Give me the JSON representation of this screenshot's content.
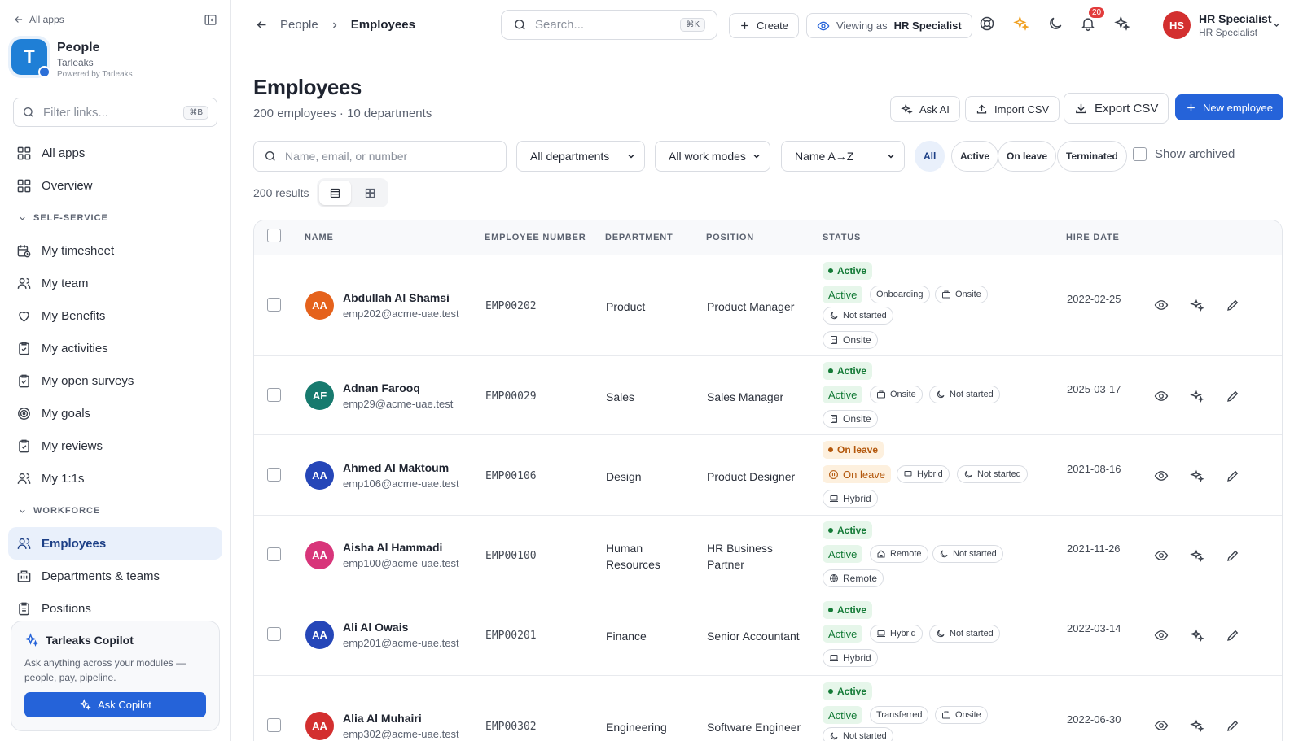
{
  "colors": {
    "accent": "#2563d9",
    "active_green": "#137a36",
    "leave_orange": "#b3570b",
    "avatar_orange": "#e5621c",
    "avatar_teal": "#177a6e",
    "avatar_blue": "#2546b8",
    "avatar_pink": "#d8357a",
    "avatar_red": "#d32f2f"
  },
  "sidebar": {
    "back_label": "All apps",
    "app_title": "People",
    "app_org": "Tarleaks",
    "app_powered": "Powered by Tarleaks",
    "logo_letter": "T",
    "filter_placeholder": "Filter links...",
    "filter_shortcut": "⌘B",
    "items_top": [
      {
        "label": "All apps",
        "icon": "grid-icon"
      },
      {
        "label": "Overview",
        "icon": "grid-icon"
      }
    ],
    "section_self": "SELF-SERVICE",
    "items_self": [
      {
        "label": "My timesheet",
        "icon": "calendar-clock-icon"
      },
      {
        "label": "My team",
        "icon": "users-icon"
      },
      {
        "label": "My Benefits",
        "icon": "heart-hand-icon"
      },
      {
        "label": "My activities",
        "icon": "clipboard-check-icon"
      },
      {
        "label": "My open surveys",
        "icon": "clipboard-check-icon"
      },
      {
        "label": "My goals",
        "icon": "target-icon"
      },
      {
        "label": "My reviews",
        "icon": "clipboard-check-icon"
      },
      {
        "label": "My 1:1s",
        "icon": "users-icon"
      }
    ],
    "section_work": "WORKFORCE",
    "items_work": [
      {
        "label": "Employees",
        "icon": "users-icon"
      },
      {
        "label": "Departments & teams",
        "icon": "building-icon"
      },
      {
        "label": "Positions",
        "icon": "clipboard-icon"
      }
    ],
    "copilot": {
      "title": "Tarleaks Copilot",
      "desc": "Ask anything across your modules — people, pay, pipeline.",
      "button": "Ask Copilot"
    }
  },
  "topbar": {
    "crumb_parent": "People",
    "crumb_current": "Employees",
    "search_placeholder": "Search...",
    "search_shortcut": "⌘K",
    "create_label": "Create",
    "viewing_prefix": "Viewing as",
    "viewing_role": "HR Specialist",
    "notif_count": "20",
    "user_initials": "HS",
    "user_name": "HR Specialist",
    "user_role": "HR Specialist"
  },
  "page": {
    "title": "Employees",
    "subtitle": "200 employees · 10 departments",
    "ask_ai": "Ask AI",
    "import_csv": "Import CSV",
    "export_csv": "Export CSV",
    "new_employee": "New employee",
    "filter_search_placeholder": "Name, email, or number",
    "dept_select": "All departments",
    "mode_select": "All work modes",
    "sort_select": "Name A→Z",
    "status_pills": [
      "All",
      "Active",
      "On leave",
      "Terminated"
    ],
    "show_archived": "Show archived",
    "results": "200 results"
  },
  "table": {
    "headers": {
      "name": "NAME",
      "number": "EMPLOYEE NUMBER",
      "department": "DEPARTMENT",
      "position": "POSITION",
      "status": "STATUS",
      "hire": "HIRE DATE"
    },
    "rows": [
      {
        "initials": "AA",
        "name": "Abdullah Al Shamsi",
        "email": "emp202@acme-uae.test",
        "number": "EMP00202",
        "department": "Product",
        "position": "Product Manager",
        "status": "Active",
        "sub_status": "Active",
        "tag1": "Onboarding",
        "tag2": "Onsite",
        "tag3": "Not started",
        "mode": "Onsite",
        "hire": "2022-02-25"
      },
      {
        "initials": "AF",
        "name": "Adnan Farooq",
        "email": "emp29@acme-uae.test",
        "number": "EMP00029",
        "department": "Sales",
        "position": "Sales Manager",
        "status": "Active",
        "sub_status": "Active",
        "tag1": "Onsite",
        "tag2": "Not started",
        "mode": "Onsite",
        "hire": "2025-03-17"
      },
      {
        "initials": "AA",
        "name": "Ahmed Al Maktoum",
        "email": "emp106@acme-uae.test",
        "number": "EMP00106",
        "department": "Design",
        "position": "Product Designer",
        "status": "On leave",
        "sub_status": "On leave",
        "tag1": "Hybrid",
        "tag2": "Not started",
        "mode": "Hybrid",
        "hire": "2021-08-16"
      },
      {
        "initials": "AA",
        "name": "Aisha Al Hammadi",
        "email": "emp100@acme-uae.test",
        "number": "EMP00100",
        "department": "Human Resources",
        "position": "HR Business Partner",
        "status": "Active",
        "sub_status": "Active",
        "tag1": "Remote",
        "tag2": "Not started",
        "mode": "Remote",
        "hire": "2021-11-26"
      },
      {
        "initials": "AA",
        "name": "Ali Al Owais",
        "email": "emp201@acme-uae.test",
        "number": "EMP00201",
        "department": "Finance",
        "position": "Senior Accountant",
        "status": "Active",
        "sub_status": "Active",
        "tag1": "Hybrid",
        "tag2": "Not started",
        "mode": "Hybrid",
        "hire": "2022-03-14"
      },
      {
        "initials": "AA",
        "name": "Alia Al Muhairi",
        "email": "emp302@acme-uae.test",
        "number": "EMP00302",
        "department": "Engineering",
        "position": "Software Engineer",
        "status": "Active",
        "sub_status": "Active",
        "tag1": "Transferred",
        "tag2": "Onsite",
        "tag3": "Not started",
        "hire": "2022-06-30"
      }
    ]
  }
}
